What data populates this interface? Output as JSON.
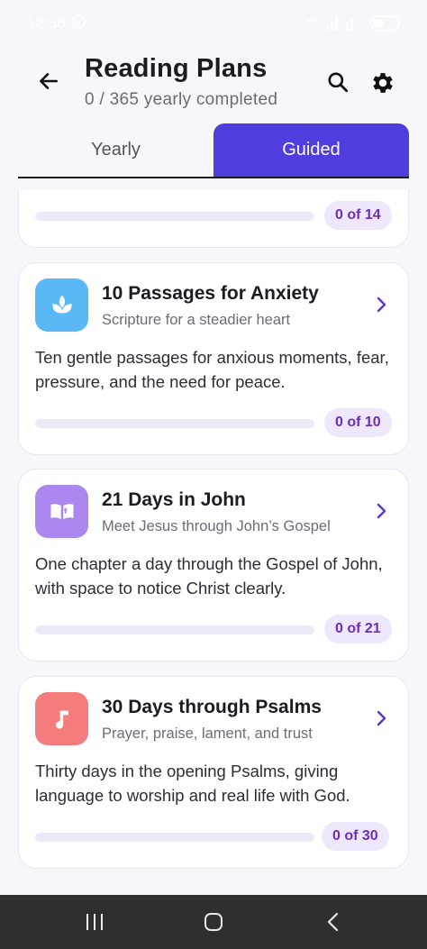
{
  "status_bar": {
    "time": "12:56"
  },
  "header": {
    "title": "Reading Plans",
    "subtitle": "0 / 365 yearly completed",
    "back_icon": "arrow-left-icon",
    "search_icon": "search-icon",
    "settings_icon": "gear-icon"
  },
  "tabs": [
    {
      "label": "Yearly",
      "active": false
    },
    {
      "label": "Guided",
      "active": true
    }
  ],
  "plans": [
    {
      "count": "0 of 14",
      "progress": 0
    },
    {
      "title": "10 Passages for Anxiety",
      "subtitle": "Scripture for a steadier heart",
      "description": "Ten gentle passages for anxious moments, fear, pressure, and the need for peace.",
      "count": "0 of 10",
      "progress": 0,
      "icon": "lotus-icon",
      "icon_color": "#5ab8f5"
    },
    {
      "title": "21 Days in John",
      "subtitle": "Meet Jesus through John’s Gospel",
      "description": "One chapter a day through the Gospel of John, with space to notice Christ clearly.",
      "count": "0 of 21",
      "progress": 0,
      "icon": "open-book-icon",
      "icon_color": "#ad87f0"
    },
    {
      "title": "30 Days through Psalms",
      "subtitle": "Prayer, praise, lament, and trust",
      "description": "Thirty days in the opening Psalms, giving language to worship and real life with God.",
      "count": "0 of 30",
      "progress": 0,
      "icon": "music-note-icon",
      "icon_color": "#f47c7c"
    }
  ],
  "colors": {
    "accent": "#4f3ddd",
    "badge_text": "#6a2fc2",
    "badge_bg": "#efe7fb"
  }
}
